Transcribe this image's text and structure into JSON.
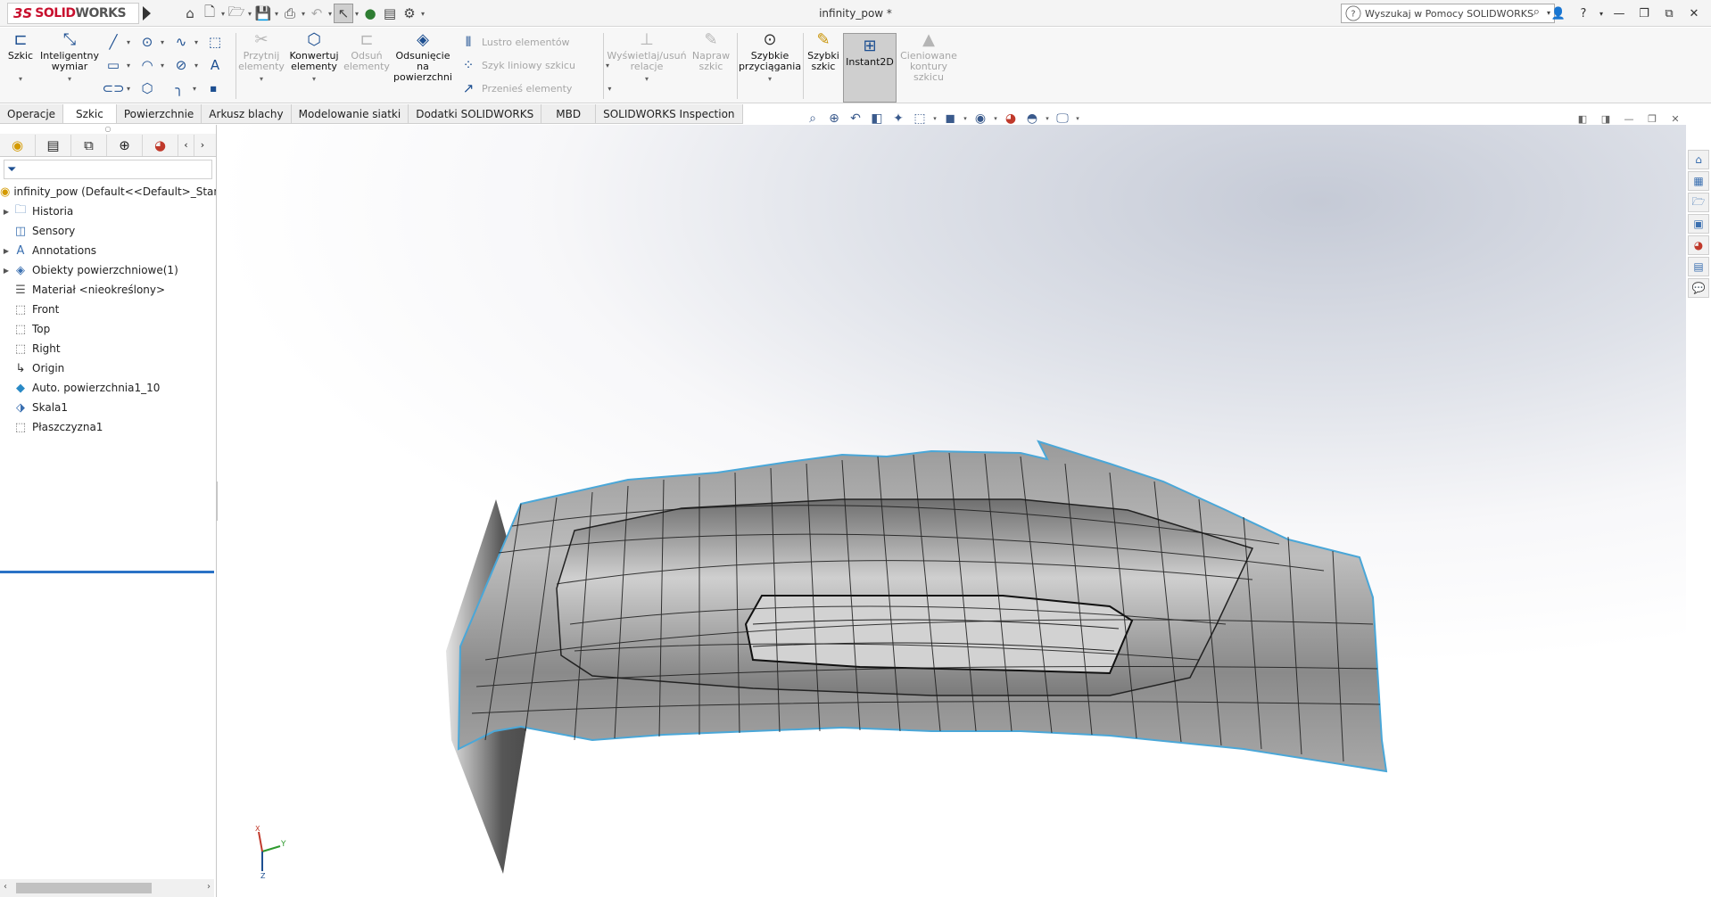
{
  "title_bar": {
    "logo_ds": "3S",
    "logo_solid": "SOLID",
    "logo_works": "WORKS",
    "document_title": "infinity_pow *",
    "search_placeholder": "Wyszukaj w Pomocy SOLIDWORKS",
    "help_label": "?"
  },
  "quick_access": [
    "home-icon",
    "new-file-icon",
    "open-icon",
    "save-icon",
    "print-icon",
    "undo-icon",
    "select-icon",
    "traffic-light-icon",
    "file-props-icon",
    "options-icon"
  ],
  "ribbon": {
    "szkic": "Szkic",
    "inteligentny_wymiar": "Inteligentny wymiar",
    "przytnij": "Przytnij elementy",
    "konwertuj": "Konwertuj elementy",
    "odsun": "Odsuń elementy",
    "odsuniecie": "Odsunięcie na powierzchni",
    "lustro": "Lustro elementów",
    "szyk_liniowy": "Szyk liniowy szkicu",
    "przenies": "Przenieś elementy",
    "wyswietlaj": "Wyświetlaj/usuń relacje",
    "napraw": "Napraw szkic",
    "szybkie_przyciagania": "Szybkie przyciągania",
    "szybki_szkic": "Szybki szkic",
    "instant2d": "Instant2D",
    "cieniowane": "Cieniowane kontury szkicu"
  },
  "tabs": [
    "Operacje",
    "Szkic",
    "Powierzchnie",
    "Arkusz blachy",
    "Modelowanie siatki",
    "Dodatki SOLIDWORKS",
    "MBD",
    "SOLIDWORKS Inspection"
  ],
  "active_tab": "Szkic",
  "feature_tree": {
    "root": "infinity_pow  (Default<<Default>_Stan w",
    "items": [
      {
        "label": "Historia",
        "icon": "history-folder-icon",
        "expandable": true
      },
      {
        "label": "Sensory",
        "icon": "sensor-icon",
        "expandable": false
      },
      {
        "label": "Annotations",
        "icon": "annotations-icon",
        "expandable": true
      },
      {
        "label": "Obiekty powierzchniowe(1)",
        "icon": "surface-bodies-icon",
        "expandable": true
      },
      {
        "label": "Materiał <nieokreślony>",
        "icon": "material-icon",
        "expandable": false
      },
      {
        "label": "Front",
        "icon": "plane-icon",
        "expandable": false
      },
      {
        "label": "Top",
        "icon": "plane-icon",
        "expandable": false
      },
      {
        "label": "Right",
        "icon": "plane-icon",
        "expandable": false
      },
      {
        "label": "Origin",
        "icon": "origin-icon",
        "expandable": false
      },
      {
        "label": "Auto. powierzchnia1_10",
        "icon": "auto-surface-icon",
        "expandable": false
      },
      {
        "label": "Skala1",
        "icon": "scale-icon",
        "expandable": false
      },
      {
        "label": "Płaszczyzna1",
        "icon": "plane-icon",
        "expandable": false
      }
    ]
  },
  "triad": {
    "x": "X",
    "y": "Y",
    "z": "Z"
  },
  "colors": {
    "accent": "#c8102e",
    "selection": "#2a72c6",
    "model_edge": "#4aa7d8"
  }
}
